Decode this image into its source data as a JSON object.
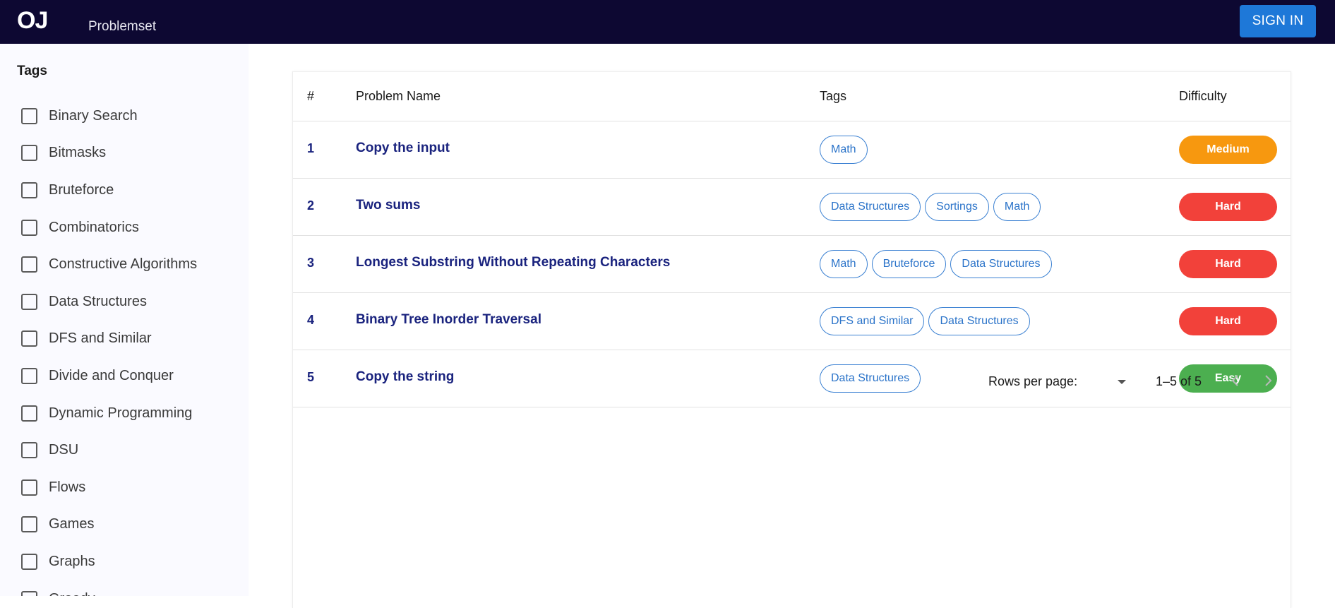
{
  "header": {
    "logo": "OJ",
    "nav_label": "Problemset",
    "signin_label": "SIGN IN"
  },
  "sidebar": {
    "title": "Tags",
    "tags": [
      "Binary Search",
      "Bitmasks",
      "Bruteforce",
      "Combinatorics",
      "Constructive Algorithms",
      "Data Structures",
      "DFS and Similar",
      "Divide and Conquer",
      "Dynamic Programming",
      "DSU",
      "Flows",
      "Games",
      "Graphs",
      "Greedy"
    ]
  },
  "table": {
    "columns": {
      "num": "#",
      "name": "Problem Name",
      "tags": "Tags",
      "difficulty": "Difficulty"
    },
    "rows": [
      {
        "num": "1",
        "name": "Copy the input",
        "tags": [
          "Math"
        ],
        "difficulty": "Medium"
      },
      {
        "num": "2",
        "name": "Two sums",
        "tags": [
          "Data Structures",
          "Sortings",
          "Math"
        ],
        "difficulty": "Hard"
      },
      {
        "num": "3",
        "name": "Longest Substring Without Repeating Characters",
        "tags": [
          "Math",
          "Bruteforce",
          "Data Structures"
        ],
        "difficulty": "Hard"
      },
      {
        "num": "4",
        "name": "Binary Tree Inorder Traversal",
        "tags": [
          "DFS and Similar",
          "Data Structures"
        ],
        "difficulty": "Hard"
      },
      {
        "num": "5",
        "name": "Copy the string",
        "tags": [
          "Data Structures"
        ],
        "difficulty": "Easy"
      }
    ],
    "difficulty_colors": {
      "Easy": "#4caf50",
      "Medium": "#f7980f",
      "Hard": "#f2413a"
    }
  },
  "pagination": {
    "rows_per_page_label": "Rows per page:",
    "range_text": "1–5 of 5",
    "prev_icon": "chevron-left-icon",
    "next_icon": "chevron-right-icon"
  }
}
